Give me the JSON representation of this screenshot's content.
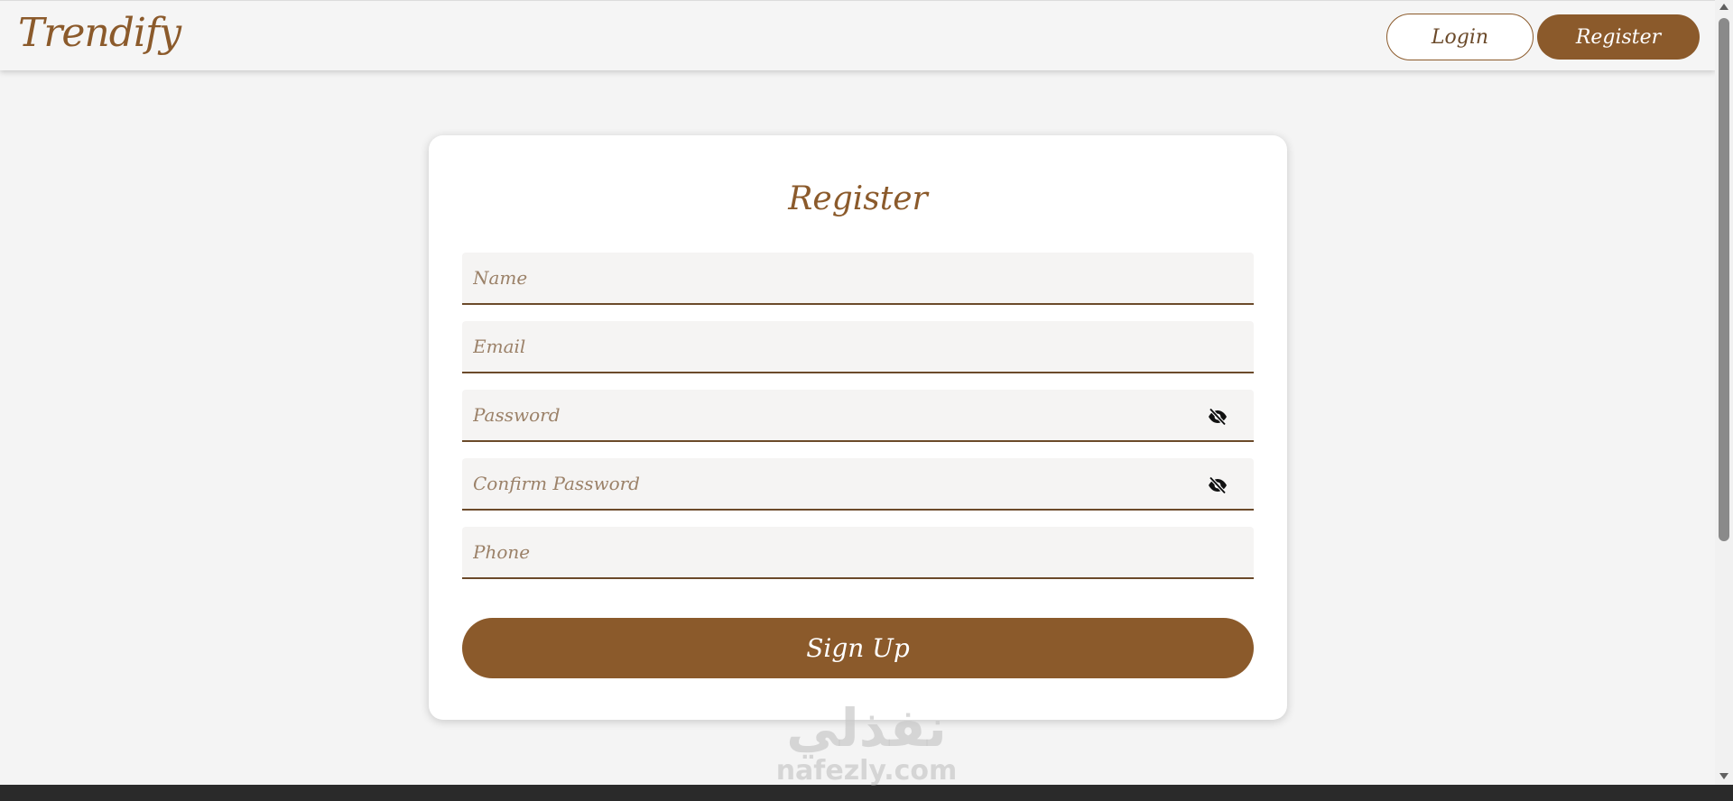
{
  "header": {
    "logo": "Trendify",
    "login_label": "Login",
    "register_label": "Register"
  },
  "form": {
    "title": "Register",
    "name_placeholder": "Name",
    "email_placeholder": "Email",
    "password_placeholder": "Password",
    "confirm_password_placeholder": "Confirm Password",
    "phone_placeholder": "Phone",
    "signup_label": "Sign Up",
    "password_toggle_icon": "eye-slash-icon",
    "confirm_password_toggle_icon": "eye-slash-icon"
  },
  "watermark": {
    "arabic": "نفذلي",
    "latin": "nafezly.com"
  },
  "colors": {
    "brand": "#8b5a2b",
    "background": "#f4f4f4",
    "card": "#ffffff",
    "footer": "#2a2a2a"
  }
}
